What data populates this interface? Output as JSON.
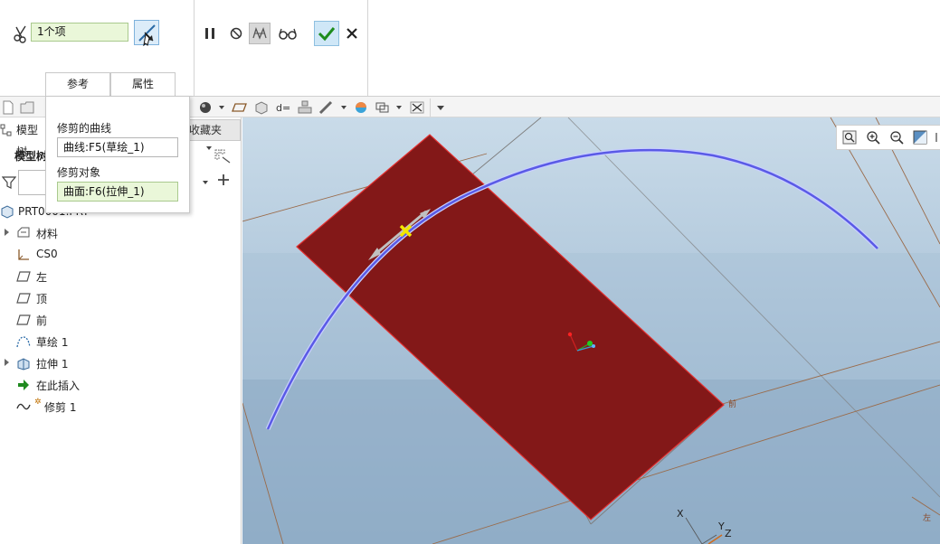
{
  "dashboard": {
    "collector_value": "1个项",
    "tabs": [
      {
        "label": "参考"
      },
      {
        "label": "属性"
      }
    ]
  },
  "references_panel": {
    "trim_curve_label": "修剪的曲线",
    "trim_curve_value": "曲线:F5(草绘_1)",
    "trim_object_label": "修剪对象",
    "trim_object_value": "曲面:F6(拉伸_1)"
  },
  "model_tree": {
    "tab_model": "模型树",
    "tab_favorites": "收藏夹",
    "label": "模型树",
    "root": "PRT0001.PRT",
    "items": [
      {
        "label": "材料",
        "icon": "materials-icon",
        "expandable": true
      },
      {
        "label": "CS0",
        "icon": "csys-icon",
        "expandable": false
      },
      {
        "label": "左",
        "icon": "datum-plane-icon",
        "expandable": false
      },
      {
        "label": "顶",
        "icon": "datum-plane-icon",
        "expandable": false
      },
      {
        "label": "前",
        "icon": "datum-plane-icon",
        "expandable": false
      },
      {
        "label": "草绘 1",
        "icon": "sketch-icon",
        "expandable": false
      },
      {
        "label": "拉伸 1",
        "icon": "extrude-icon",
        "expandable": true
      },
      {
        "label": "在此插入",
        "icon": "insert-here-icon",
        "expandable": false
      },
      {
        "label": "修剪 1",
        "icon": "trim-icon",
        "expandable": false
      }
    ]
  },
  "graphics": {
    "plane_labels": {
      "front": "前",
      "left": "左"
    },
    "csys_labels": {
      "x": "X",
      "y": "Y",
      "z": "Z"
    },
    "colors": {
      "surface": "#831818",
      "curve": "#5a5ae6",
      "bg_top": "#c9dbe9",
      "bg_bottom": "#8fadc8",
      "marker": "#f2e600"
    }
  }
}
